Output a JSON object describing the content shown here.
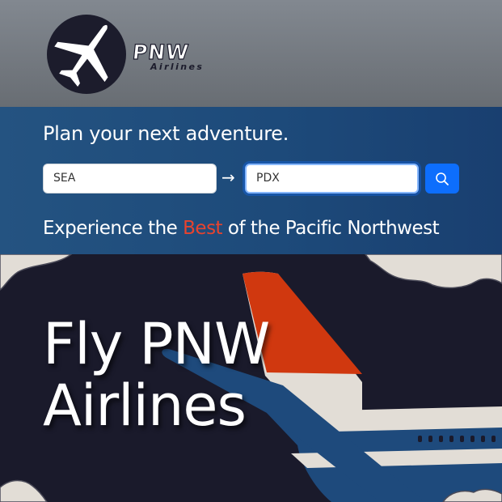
{
  "brand": {
    "name": "PNW",
    "subtitle": "Airlines",
    "logo_icon": "airplane-icon"
  },
  "search": {
    "tagline": "Plan your next adventure.",
    "origin_value": "SEA",
    "destination_value": "PDX",
    "arrow_icon": "→",
    "search_icon": "search-icon"
  },
  "slogan": {
    "before": "Experience the ",
    "highlight": "Best",
    "after": " of the Pacific Northwest"
  },
  "hero": {
    "title_line1": "Fly PNW",
    "title_line2": "Airlines"
  },
  "colors": {
    "header_bg": "#828890",
    "band_bg": "#1d4a7a",
    "accent_red": "#e8432e",
    "button_blue": "#0d6efd",
    "hero_bg": "#1a1a2b",
    "plane_blue": "#1e4a7c",
    "tail_red": "#d0380f",
    "cloud": "#e2ddd6"
  }
}
